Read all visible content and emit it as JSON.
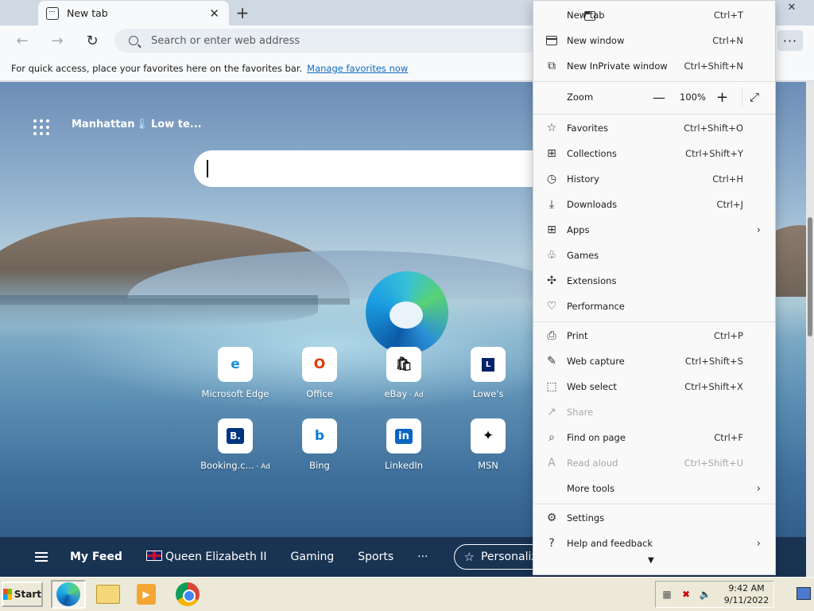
{
  "tab": {
    "title": "New tab",
    "close": "✕",
    "new": "+"
  },
  "window": {
    "close": "✕"
  },
  "toolbar": {
    "back": "←",
    "forward": "→",
    "refresh": "↻",
    "more": "···"
  },
  "address": {
    "placeholder": "Search or enter web address"
  },
  "favorites_bar": {
    "text": "For quick access, place your favorites here on the favorites bar.",
    "link": "Manage favorites now"
  },
  "newtab": {
    "location": "Manhattan",
    "weather": "Low te...",
    "quick_links": [
      {
        "label": "Microsoft Edge",
        "ad": "",
        "glyph": "e",
        "color": "#1b8fd6"
      },
      {
        "label": "Office",
        "ad": "",
        "glyph": "O",
        "color": "#d83b01"
      },
      {
        "label": "eBay",
        "ad": " · Ad",
        "glyph": "🛍",
        "color": "#333333"
      },
      {
        "label": "Lowe's",
        "ad": "",
        "glyph": "L",
        "color": "#012169"
      },
      {
        "label": "Booking.c...",
        "ad": " · Ad",
        "glyph": "B.",
        "color": "#003580"
      },
      {
        "label": "Bing",
        "ad": "",
        "glyph": "b",
        "color": "#0c7bd6"
      },
      {
        "label": "LinkedIn",
        "ad": "",
        "glyph": "in",
        "color": "#0a66c2"
      },
      {
        "label": "MSN",
        "ad": "",
        "glyph": "✦",
        "color": "#111111"
      }
    ],
    "feed": {
      "my_feed": "My Feed",
      "queen": "Queen Elizabeth II",
      "gaming": "Gaming",
      "sports": "Sports",
      "more": "···",
      "personalize": "Personalize"
    }
  },
  "menu": {
    "new_tab": {
      "label": "New tab",
      "shortcut": "Ctrl+T"
    },
    "new_window": {
      "label": "New window",
      "shortcut": "Ctrl+N"
    },
    "inprivate": {
      "label": "New InPrivate window",
      "shortcut": "Ctrl+Shift+N"
    },
    "zoom": {
      "label": "Zoom",
      "value": "100%",
      "minus": "—",
      "plus": "+"
    },
    "favorites": {
      "label": "Favorites",
      "shortcut": "Ctrl+Shift+O"
    },
    "collections": {
      "label": "Collections",
      "shortcut": "Ctrl+Shift+Y"
    },
    "history": {
      "label": "History",
      "shortcut": "Ctrl+H"
    },
    "downloads": {
      "label": "Downloads",
      "shortcut": "Ctrl+J"
    },
    "apps": {
      "label": "Apps"
    },
    "games": {
      "label": "Games"
    },
    "extensions": {
      "label": "Extensions"
    },
    "performance": {
      "label": "Performance"
    },
    "print": {
      "label": "Print",
      "shortcut": "Ctrl+P"
    },
    "web_capture": {
      "label": "Web capture",
      "shortcut": "Ctrl+Shift+S"
    },
    "web_select": {
      "label": "Web select",
      "shortcut": "Ctrl+Shift+X"
    },
    "share": {
      "label": "Share"
    },
    "find": {
      "label": "Find on page",
      "shortcut": "Ctrl+F"
    },
    "read_aloud": {
      "label": "Read aloud",
      "shortcut": "Ctrl+Shift+U"
    },
    "more_tools": {
      "label": "More tools"
    },
    "settings": {
      "label": "Settings"
    },
    "help": {
      "label": "Help and feedback"
    },
    "arrow": "›",
    "scroll_more": "▼"
  },
  "taskbar": {
    "start": "Start",
    "time": "9:42 AM",
    "date": "9/11/2022"
  }
}
